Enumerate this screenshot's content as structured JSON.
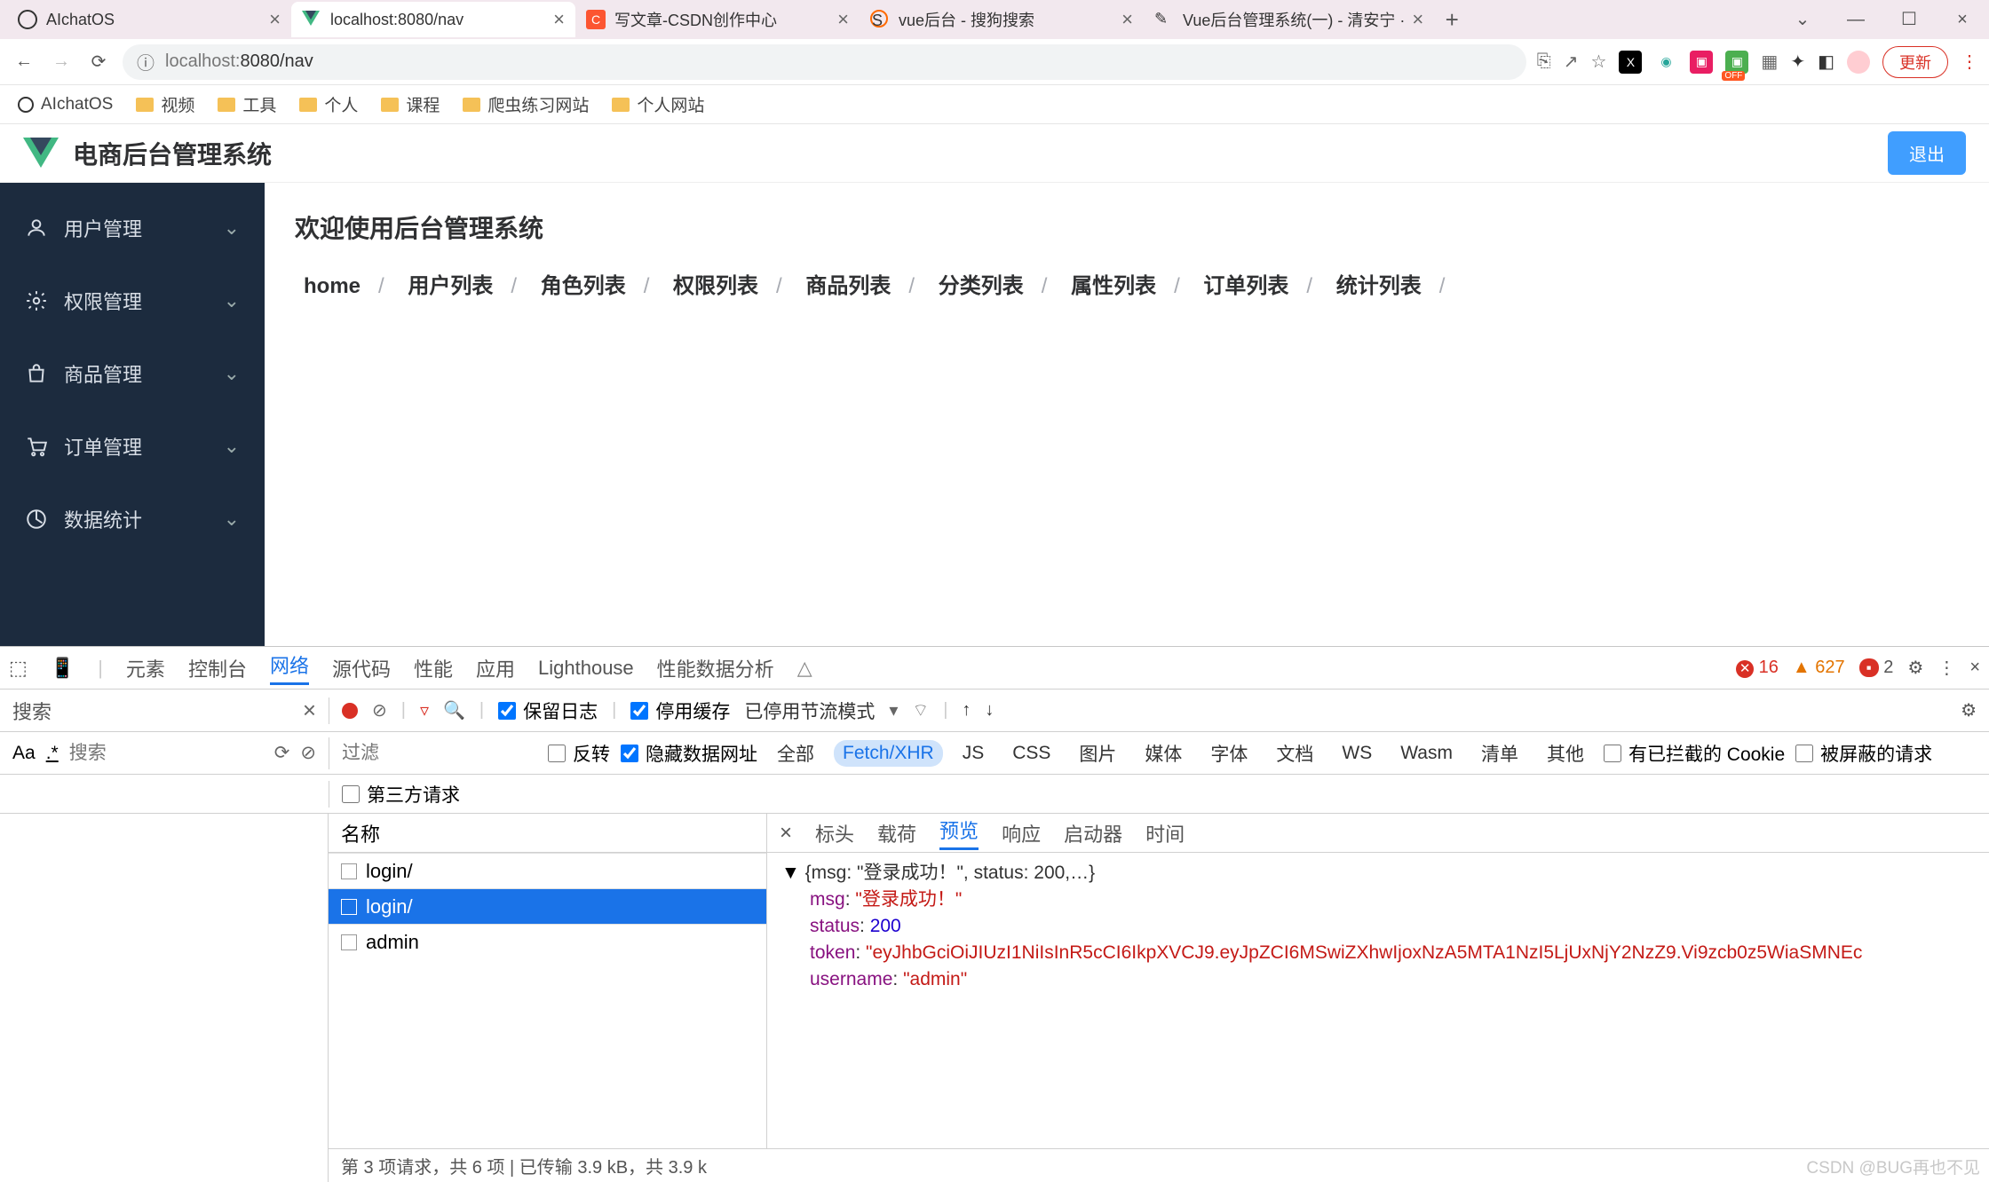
{
  "browser": {
    "tabs": [
      {
        "title": "AIchatOS",
        "active": false
      },
      {
        "title": "localhost:8080/nav",
        "active": true
      },
      {
        "title": "写文章-CSDN创作中心",
        "active": false
      },
      {
        "title": "vue后台 - 搜狗搜索",
        "active": false
      },
      {
        "title": "Vue后台管理系统(一) - 清安宁 ·",
        "active": false
      }
    ],
    "url_host": "localhost:",
    "url_path": "8080/nav",
    "update_label": "更新",
    "bookmarks": [
      "AIchatOS",
      "视频",
      "工具",
      "个人",
      "课程",
      "爬虫练习网站",
      "个人网站"
    ]
  },
  "app": {
    "title": "电商后台管理系统",
    "logout": "退出",
    "sidebar": [
      "用户管理",
      "权限管理",
      "商品管理",
      "订单管理",
      "数据统计"
    ],
    "welcome": "欢迎使用后台管理系统",
    "breadcrumb": [
      "home",
      "用户列表",
      "角色列表",
      "权限列表",
      "商品列表",
      "分类列表",
      "属性列表",
      "订单列表",
      "统计列表"
    ]
  },
  "devtools": {
    "main_tabs": [
      "元素",
      "控制台",
      "网络",
      "源代码",
      "性能",
      "应用",
      "Lighthouse",
      "性能数据分析"
    ],
    "active_tab": "网络",
    "errors": "16",
    "warnings": "627",
    "issues": "2",
    "search_label": "搜索",
    "search_placeholder": "搜索",
    "preserve_log": "保留日志",
    "disable_cache": "停用缓存",
    "throttling": "已停用节流模式",
    "filter_placeholder": "过滤",
    "invert": "反转",
    "hide_data_urls": "隐藏数据网址",
    "types": [
      "全部",
      "Fetch/XHR",
      "JS",
      "CSS",
      "图片",
      "媒体",
      "字体",
      "文档",
      "WS",
      "Wasm",
      "清单",
      "其他"
    ],
    "active_type": "Fetch/XHR",
    "blocked_cookies": "有已拦截的 Cookie",
    "blocked_requests": "被屏蔽的请求",
    "third_party": "第三方请求",
    "name_header": "名称",
    "requests": [
      "login/",
      "login/",
      "admin"
    ],
    "selected_request": 1,
    "detail_tabs": [
      "标头",
      "载荷",
      "预览",
      "响应",
      "启动器",
      "时间"
    ],
    "active_detail": "预览",
    "response": {
      "summary": "{msg: \"登录成功！\", status: 200,…}",
      "msg": "\"登录成功！\"",
      "status": "200",
      "token": "\"eyJhbGciOiJIUzI1NiIsInR5cCI6IkpXVCJ9.eyJpZCI6MSwiZXhwIjoxNzA5MTA1NzI5LjUxNjY2NzZ9.Vi9zcb0z5WiaSMNEc",
      "username": "\"admin\""
    },
    "status_bar": "第 3 项请求，共 6 项   |   已传输 3.9 kB，共 3.9 k",
    "match_case": "Aa",
    "regex": ".*"
  },
  "watermark": "CSDN @BUG再也不见"
}
